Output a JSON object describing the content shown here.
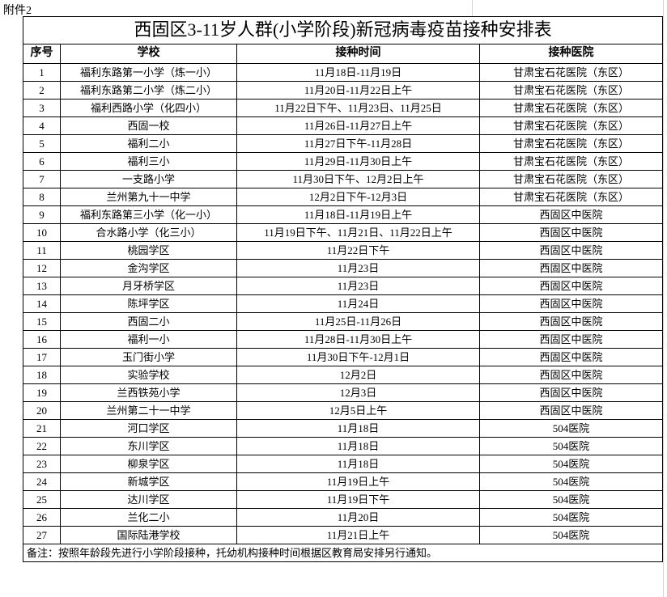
{
  "attachment_label": "附件2",
  "title": "西固区3-11岁人群(小学阶段)新冠病毒疫苗接种安排表",
  "headers": {
    "seq": "序号",
    "school": "学校",
    "time": "接种时间",
    "hospital": "接种医院"
  },
  "rows": [
    {
      "seq": "1",
      "school": "福利东路第一小学（炼一小）",
      "time": "11月18日-11月19日",
      "hospital": "甘肃宝石花医院（东区）"
    },
    {
      "seq": "2",
      "school": "福利东路第二小学（炼二小）",
      "time": "11月20日-11月22日上午",
      "hospital": "甘肃宝石花医院（东区）"
    },
    {
      "seq": "3",
      "school": "福利西路小学（化四小）",
      "time": "11月22日下午、11月23日、11月25日",
      "hospital": "甘肃宝石花医院（东区）"
    },
    {
      "seq": "4",
      "school": "西固一校",
      "time": "11月26日-11月27日上午",
      "hospital": "甘肃宝石花医院（东区）"
    },
    {
      "seq": "5",
      "school": "福利二小",
      "time": "11月27日下午-11月28日",
      "hospital": "甘肃宝石花医院（东区）"
    },
    {
      "seq": "6",
      "school": "福利三小",
      "time": "11月29日-11月30日上午",
      "hospital": "甘肃宝石花医院（东区）"
    },
    {
      "seq": "7",
      "school": "一支路小学",
      "time": "11月30日下午、12月2日上午",
      "hospital": "甘肃宝石花医院（东区）"
    },
    {
      "seq": "8",
      "school": "兰州第九十一中学",
      "time": "12月2日下午-12月3日",
      "hospital": "甘肃宝石花医院（东区）"
    },
    {
      "seq": "9",
      "school": "福利东路第三小学（化一小）",
      "time": "11月18日-11月19日上午",
      "hospital": "西固区中医院"
    },
    {
      "seq": "10",
      "school": "合水路小学（化三小）",
      "time": "11月19日下午、11月21日、11月22日上午",
      "hospital": "西固区中医院"
    },
    {
      "seq": "11",
      "school": "桃园学区",
      "time": "11月22日下午",
      "hospital": "西固区中医院"
    },
    {
      "seq": "12",
      "school": "金沟学区",
      "time": "11月23日",
      "hospital": "西固区中医院"
    },
    {
      "seq": "13",
      "school": "月牙桥学区",
      "time": "11月23日",
      "hospital": "西固区中医院"
    },
    {
      "seq": "14",
      "school": "陈坪学区",
      "time": "11月24日",
      "hospital": "西固区中医院"
    },
    {
      "seq": "15",
      "school": "西固二小",
      "time": "11月25日-11月26日",
      "hospital": "西固区中医院"
    },
    {
      "seq": "16",
      "school": "福利一小",
      "time": "11月28日-11月30日上午",
      "hospital": "西固区中医院"
    },
    {
      "seq": "17",
      "school": "玉门街小学",
      "time": "11月30日下午-12月1日",
      "hospital": "西固区中医院"
    },
    {
      "seq": "18",
      "school": "实验学校",
      "time": "12月2日",
      "hospital": "西固区中医院"
    },
    {
      "seq": "19",
      "school": "兰西铁苑小学",
      "time": "12月3日",
      "hospital": "西固区中医院"
    },
    {
      "seq": "20",
      "school": "兰州第二十一中学",
      "time": "12月5日上午",
      "hospital": "西固区中医院"
    },
    {
      "seq": "21",
      "school": "河口学区",
      "time": "11月18日",
      "hospital": "504医院"
    },
    {
      "seq": "22",
      "school": "东川学区",
      "time": "11月18日",
      "hospital": "504医院"
    },
    {
      "seq": "23",
      "school": "柳泉学区",
      "time": "11月18日",
      "hospital": "504医院"
    },
    {
      "seq": "24",
      "school": "新城学区",
      "time": "11月19日上午",
      "hospital": "504医院"
    },
    {
      "seq": "25",
      "school": "达川学区",
      "time": "11月19日下午",
      "hospital": "504医院"
    },
    {
      "seq": "26",
      "school": "兰化二小",
      "time": "11月20日",
      "hospital": "504医院"
    },
    {
      "seq": "27",
      "school": "国际陆港学校",
      "time": "11月21日上午",
      "hospital": "504医院"
    }
  ],
  "note": "备注：按照年龄段先进行小学阶段接种，托幼机构接种时间根据区教育局安排另行通知。"
}
